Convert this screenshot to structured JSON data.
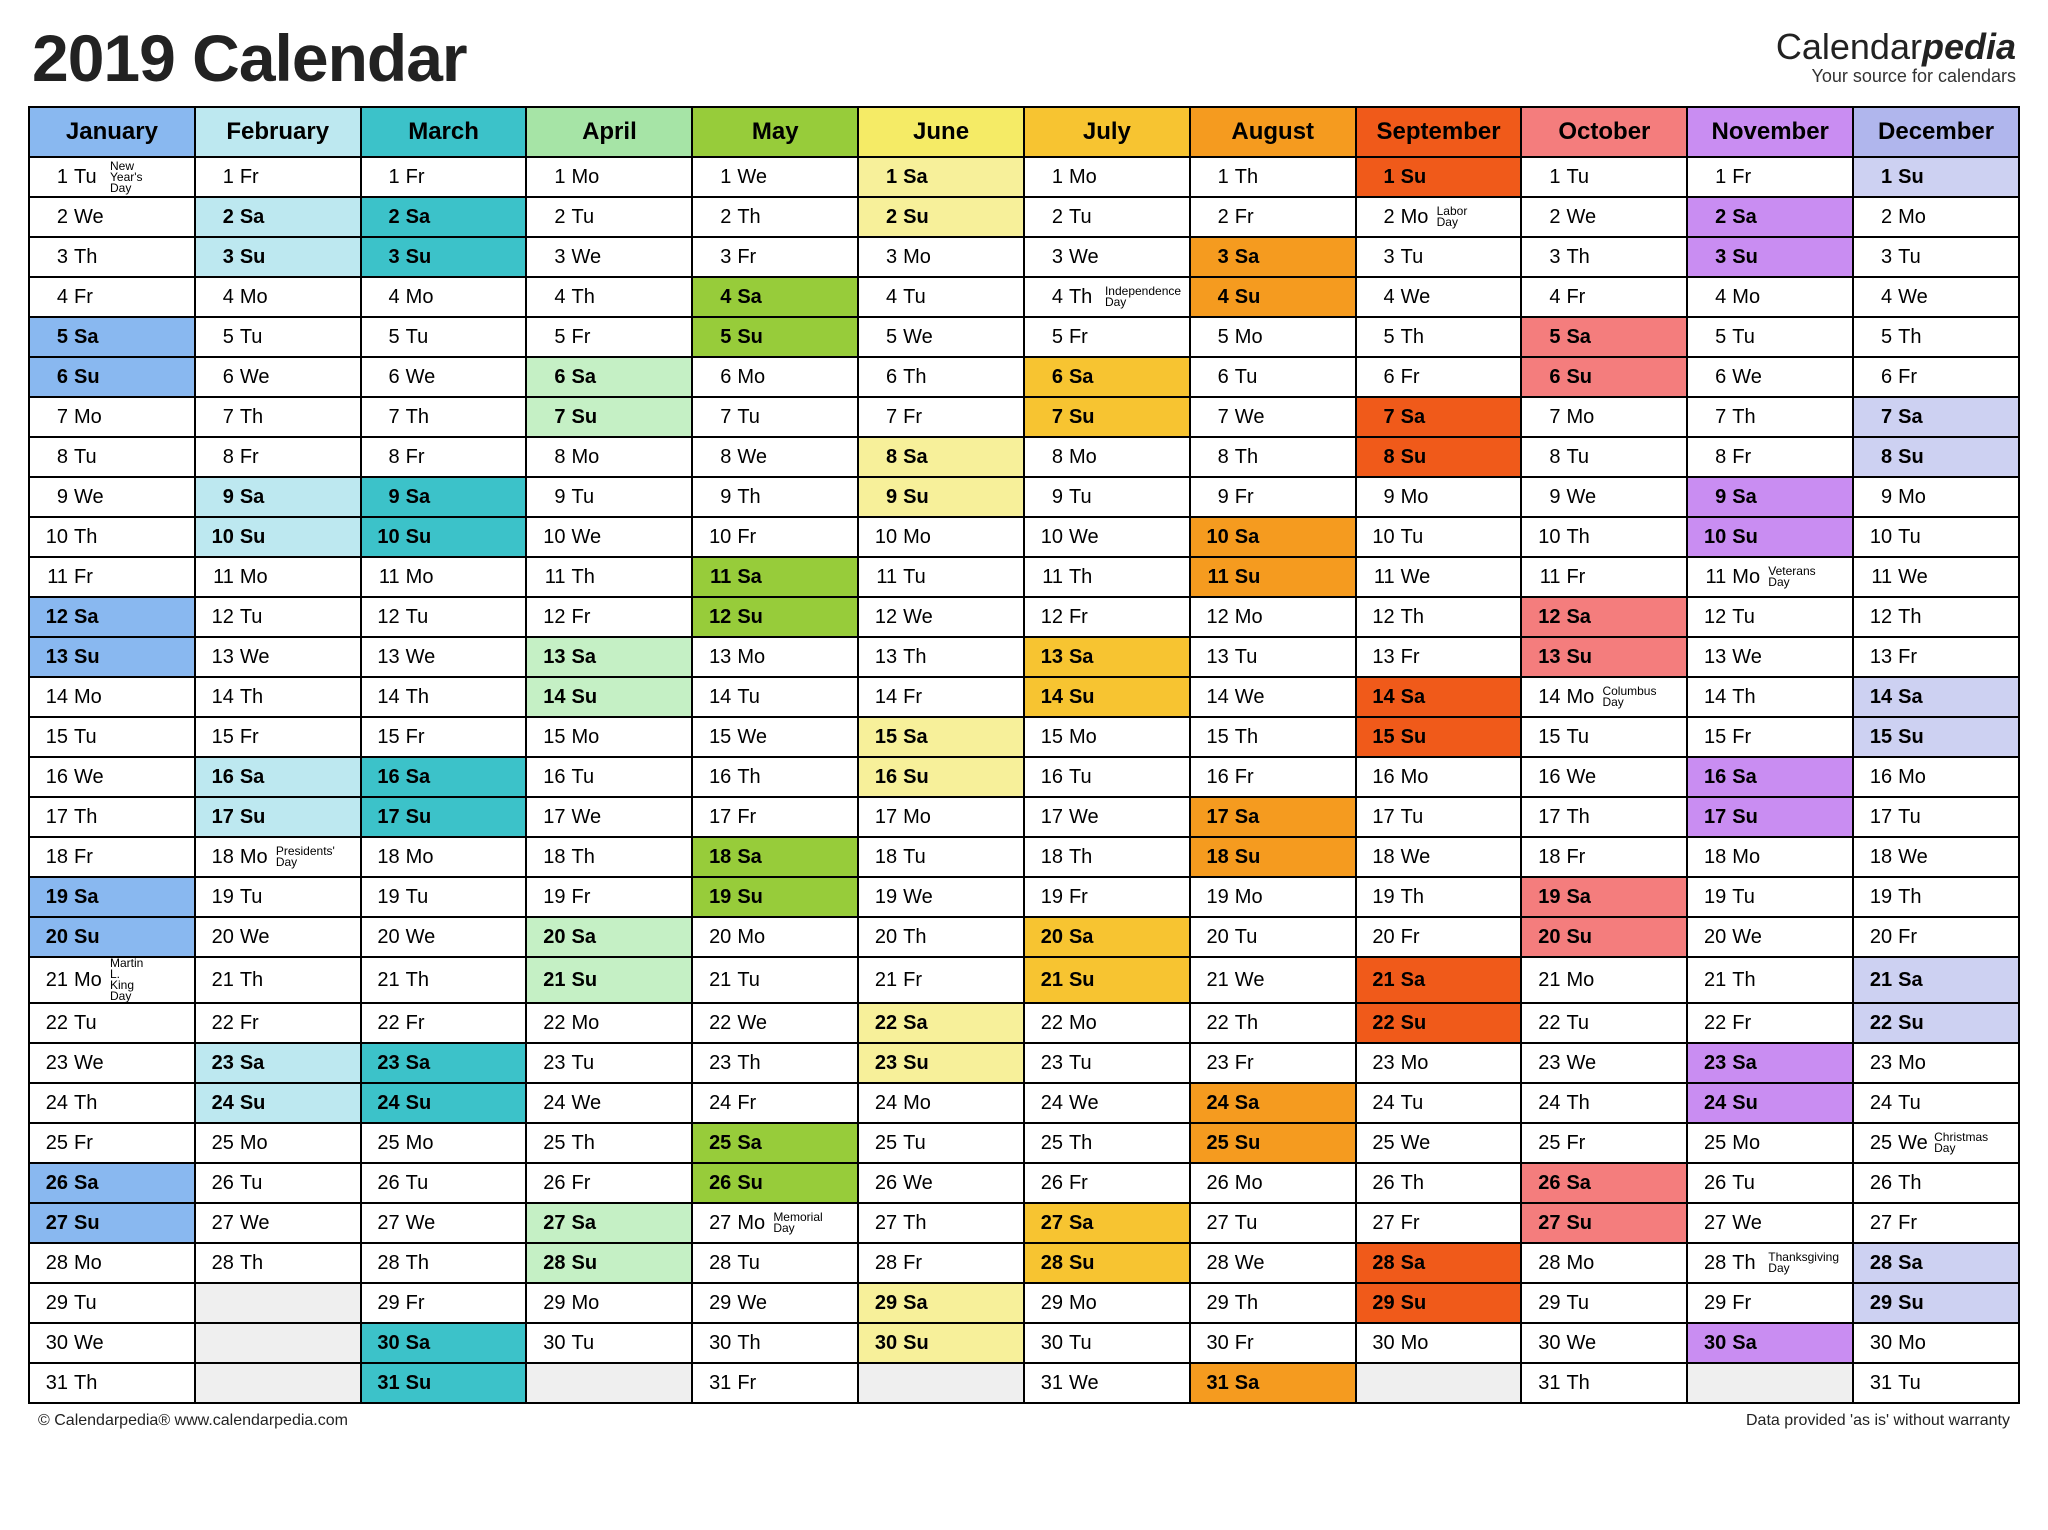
{
  "title": "2019 Calendar",
  "brand": {
    "name_plain": "Calendar",
    "name_bold": "pedia",
    "tagline": "Your source for calendars"
  },
  "footer": {
    "left": "© Calendarpedia®   www.calendarpedia.com",
    "right": "Data provided 'as is' without warranty"
  },
  "dow": [
    "Su",
    "Mo",
    "Tu",
    "We",
    "Th",
    "Fr",
    "Sa"
  ],
  "months": [
    {
      "name": "January",
      "days": 31,
      "start": 2,
      "header_bg": "#89b8f0",
      "wk_bg": "#89b8f0",
      "holidays": {
        "1": "New Year's Day",
        "21": "Martin L. King Day"
      }
    },
    {
      "name": "February",
      "days": 28,
      "start": 5,
      "header_bg": "#bde8f0",
      "wk_bg": "#bde8f0",
      "holidays": {
        "18": "Presidents' Day"
      }
    },
    {
      "name": "March",
      "days": 31,
      "start": 5,
      "header_bg": "#3cc2c9",
      "wk_bg": "#3cc2c9",
      "holidays": {}
    },
    {
      "name": "April",
      "days": 30,
      "start": 1,
      "header_bg": "#a6e4a6",
      "wk_bg": "#c5f0c5",
      "holidays": {}
    },
    {
      "name": "May",
      "days": 31,
      "start": 3,
      "header_bg": "#97cc3a",
      "wk_bg": "#97cc3a",
      "holidays": {
        "27": "Memorial Day"
      }
    },
    {
      "name": "June",
      "days": 30,
      "start": 6,
      "header_bg": "#f5eb66",
      "wk_bg": "#f7f09a",
      "holidays": {}
    },
    {
      "name": "July",
      "days": 31,
      "start": 1,
      "header_bg": "#f7c431",
      "wk_bg": "#f7c431",
      "holidays": {
        "4": "Independence Day"
      }
    },
    {
      "name": "August",
      "days": 31,
      "start": 4,
      "header_bg": "#f59b1f",
      "wk_bg": "#f59b1f",
      "holidays": {}
    },
    {
      "name": "September",
      "days": 30,
      "start": 0,
      "header_bg": "#f05a1a",
      "wk_bg": "#f05a1a",
      "holidays": {
        "2": "Labor Day"
      }
    },
    {
      "name": "October",
      "days": 31,
      "start": 2,
      "header_bg": "#f47d7d",
      "wk_bg": "#f47d7d",
      "holidays": {
        "14": "Columbus Day"
      }
    },
    {
      "name": "November",
      "days": 30,
      "start": 5,
      "header_bg": "#c98df2",
      "wk_bg": "#c98df2",
      "holidays": {
        "11": "Veterans Day",
        "28": "Thanksgiving Day"
      }
    },
    {
      "name": "December",
      "days": 31,
      "start": 0,
      "header_bg": "#b0b6ed",
      "wk_bg": "#cdd1f2",
      "holidays": {
        "25": "Christmas Day"
      }
    }
  ]
}
